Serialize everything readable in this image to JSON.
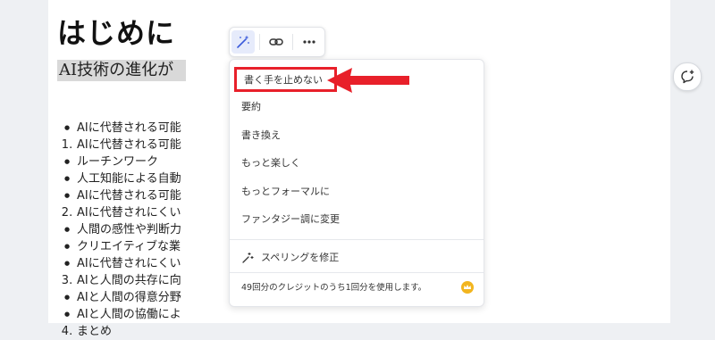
{
  "document": {
    "title": "はじめに",
    "selected_text": "AI技術の進化が",
    "outline": [
      {
        "marker": "bullet",
        "text": "AIに代替される可能"
      },
      {
        "marker": "1.",
        "text": "AIに代替される可能"
      },
      {
        "marker": "bullet",
        "text": "ルーチンワーク"
      },
      {
        "marker": "bullet",
        "text": "人工知能による自動"
      },
      {
        "marker": "bullet",
        "text": "AIに代替される可能"
      },
      {
        "marker": "2.",
        "text": "AIに代替されにくい"
      },
      {
        "marker": "bullet",
        "text": "人間の感性や判断力"
      },
      {
        "marker": "bullet",
        "text": "クリエイティブな業"
      },
      {
        "marker": "bullet",
        "text": "AIに代替されにくい"
      },
      {
        "marker": "3.",
        "text": "AIと人間の共存に向"
      },
      {
        "marker": "bullet",
        "text": "AIと人間の得意分野"
      },
      {
        "marker": "bullet",
        "text": "AIと人間の協働によ"
      },
      {
        "marker": "4.",
        "text": "まとめ"
      }
    ]
  },
  "toolbar": {
    "ai_icon": "magic-wand-icon",
    "link_icon": "link-icon",
    "more_icon": "more-horizontal-icon"
  },
  "ai_menu": {
    "items": [
      "書く手を止めない",
      "要約",
      "書き換え",
      "もっと楽しく",
      "もっとフォーマルに",
      "ファンタジー調に変更"
    ],
    "spelling": "スペリングを修正",
    "credits": "49回分のクレジットのうち1回分を使用します。"
  },
  "colors": {
    "highlight_border": "#e8202a",
    "arrow": "#e8202a",
    "crown_badge": "#f2b51f",
    "ai_button_bg": "#e6ebfb"
  }
}
